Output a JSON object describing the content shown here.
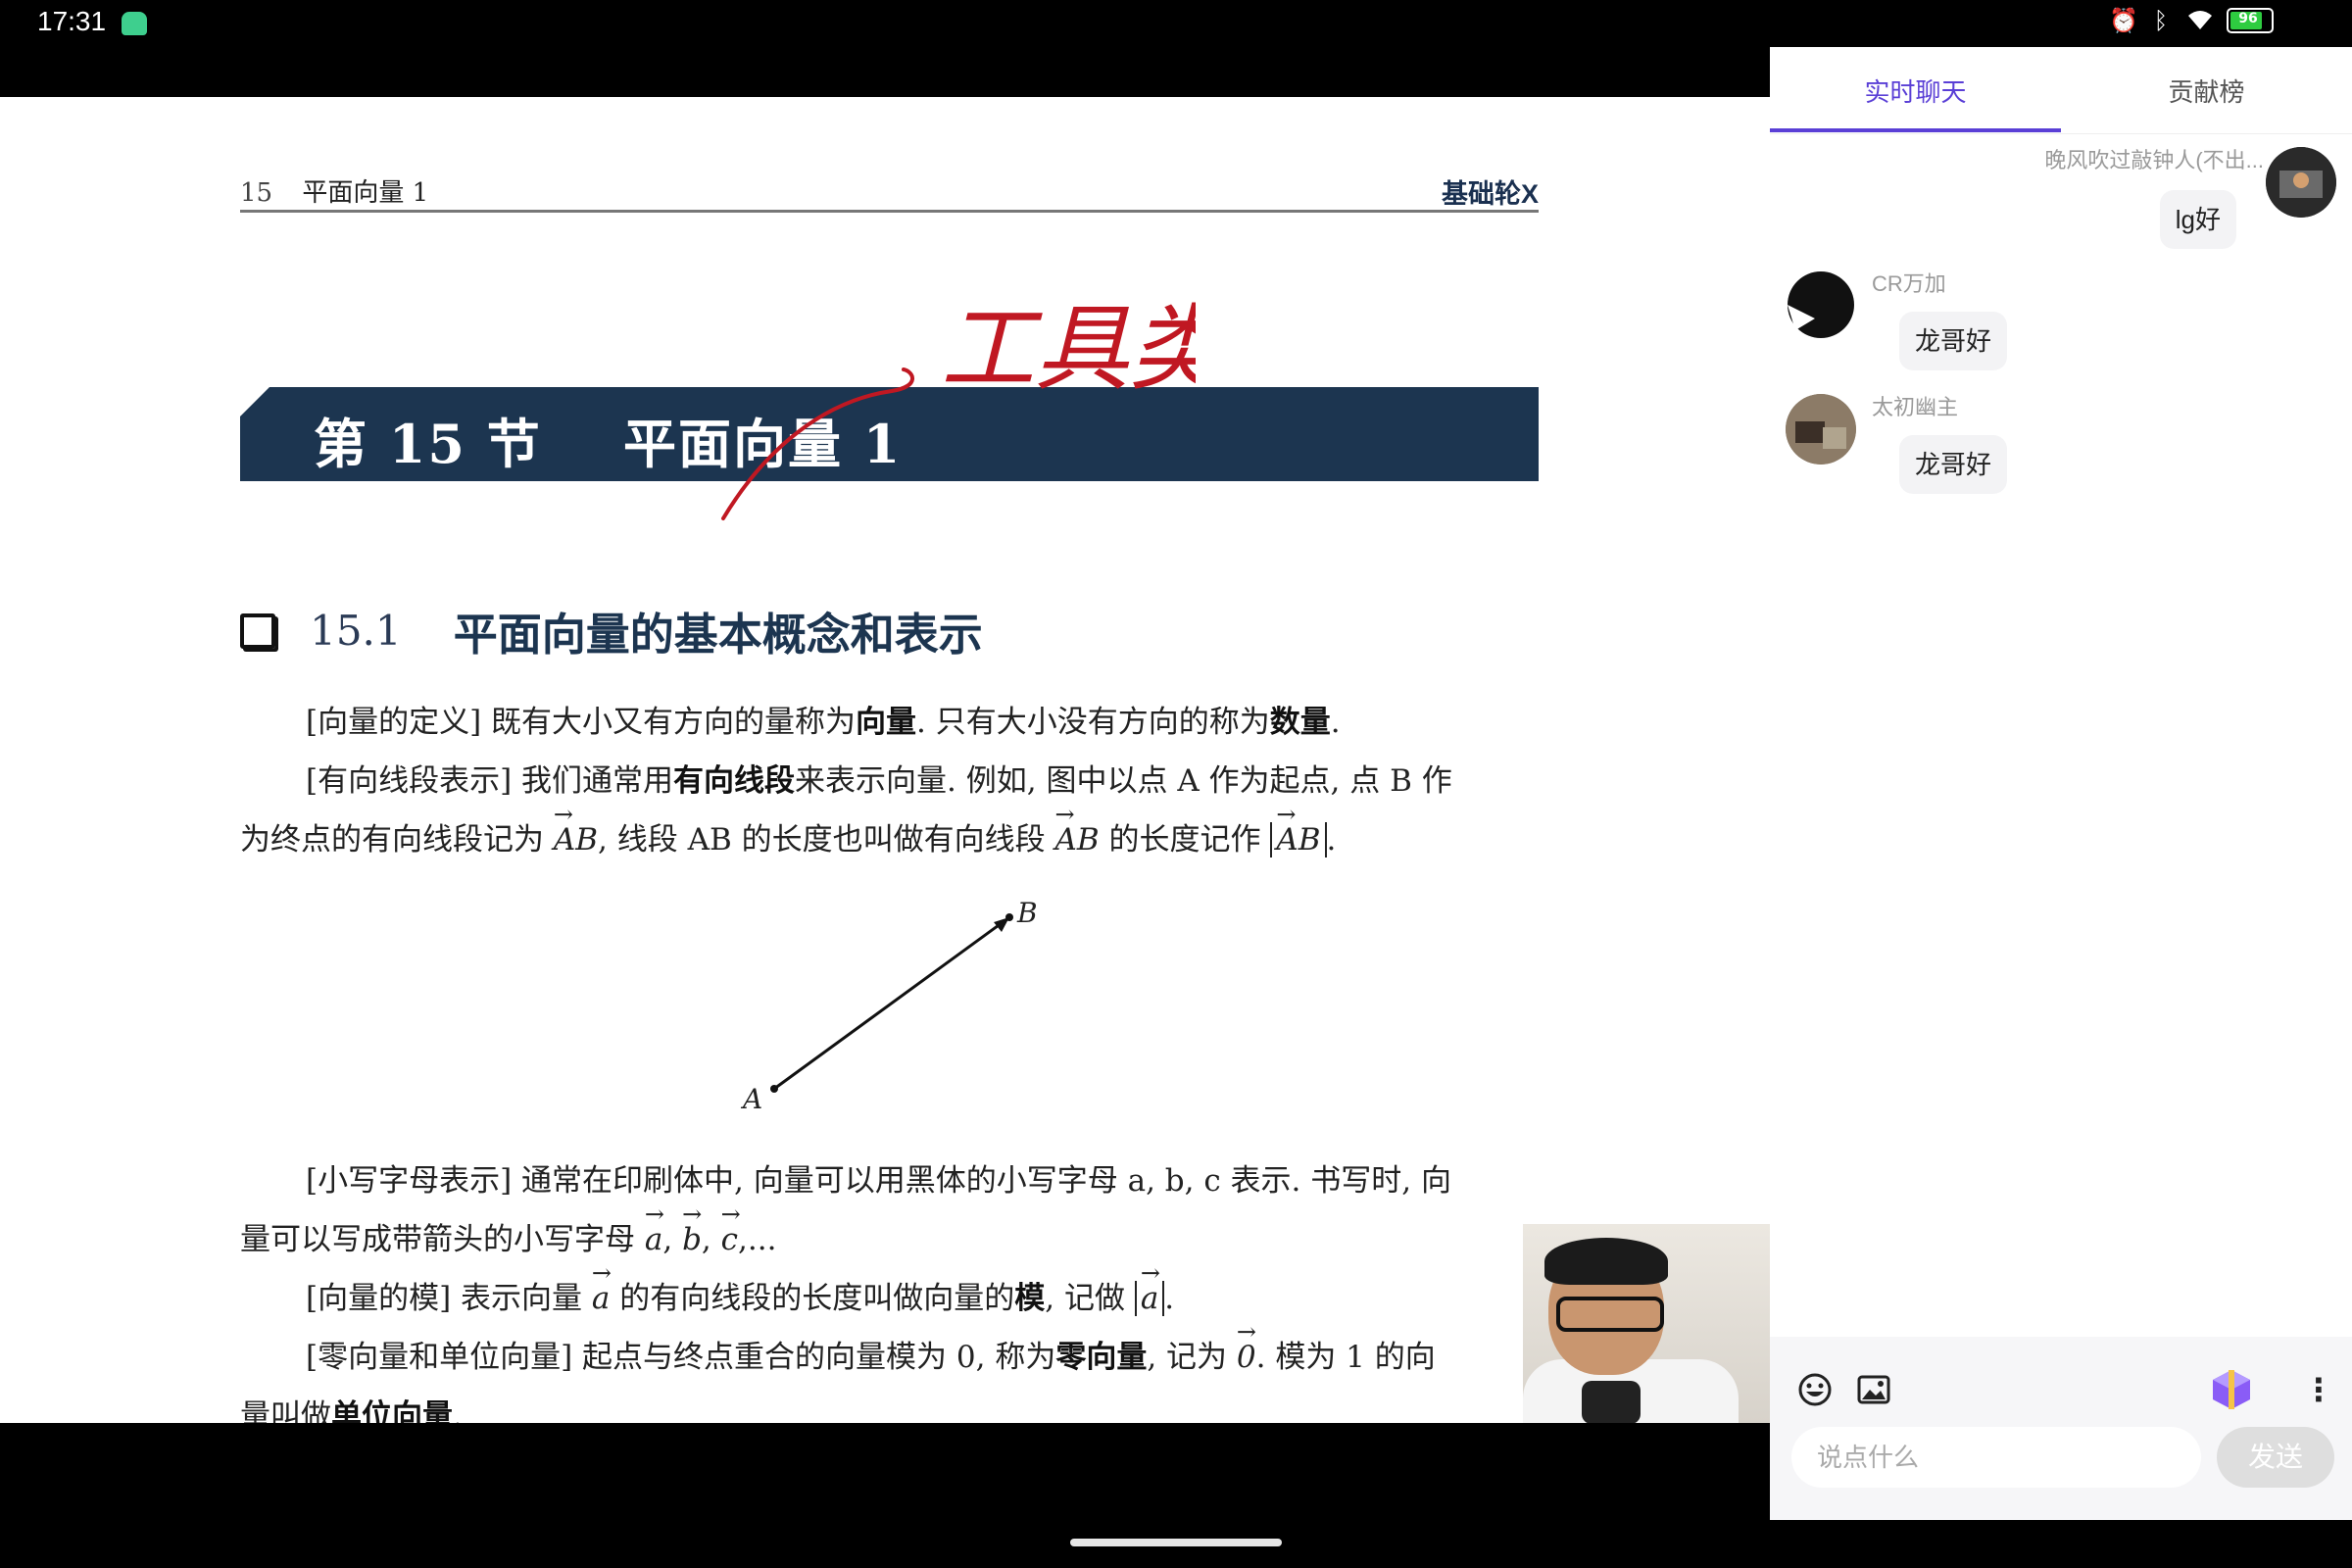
{
  "status_bar": {
    "time": "17:31",
    "battery": "96"
  },
  "document": {
    "header_num": "15",
    "header_title": "平面向量 1",
    "header_right": "基础轮X",
    "banner": "第 15 节    平面向量 1",
    "handwriting": "工具类",
    "h2_num": "15.1",
    "h2_title": "平面向量的基本概念和表示",
    "p1": {
      "a": "[向量的定义] 既有大小又有方向的量称为",
      "b1": "向量",
      "c": ". 只有大小没有方向的称为",
      "b2": "数量",
      "d": "."
    },
    "p2": {
      "a": "[有向线段表示] 我们通常用",
      "b": "有向线段",
      "c": "来表示向量. 例如, 图中以点 A 作为起点, 点 B 作"
    },
    "p3": {
      "a": "为终点的有向线段记为 ",
      "v1": "AB",
      "c": ", 线段 AB 的长度也叫做有向线段 ",
      "v2": "AB",
      "d": " 的长度记作 ",
      "v3": "AB",
      "e": "."
    },
    "figure": {
      "label_a": "A",
      "label_b": "B"
    },
    "p4": "[小写字母表示] 通常在印刷体中, 向量可以用黑体的小写字母 a, b, c 表示. 书写时, 向",
    "p5": {
      "a": "量可以写成带箭头的小写字母 ",
      "v1": "a",
      "v2": "b",
      "v3": "c",
      "end": ",..."
    },
    "p6": {
      "a": "[向量的模] 表示向量 ",
      "v1": "a",
      "c": " 的有向线段的长度叫做向量的",
      "b": "模",
      "d": ", 记做 ",
      "v2": "a",
      "e": "."
    },
    "p7": {
      "a": "[零向量和单位向量] 起点与终点重合的向量模为 0, 称为",
      "b": "零向量",
      "c": ", 记为 ",
      "v": "0",
      "d": ". 模为 1 的向"
    },
    "p8": {
      "a": "量叫做",
      "b": "单位向量",
      "c": "."
    }
  },
  "chat": {
    "tabs": [
      "实时聊天",
      "贡献榜"
    ],
    "messages": [
      {
        "name": "晚风吹过敲钟人(不出...",
        "text": "lg好"
      },
      {
        "name": "CR万加",
        "text": "龙哥好"
      },
      {
        "name": "太初幽主",
        "text": "龙哥好"
      }
    ],
    "input_placeholder": "说点什么",
    "send_label": "发送"
  },
  "colors": {
    "accent": "#5a3fd6",
    "banner": "#1c3550",
    "ink": "#c01822"
  }
}
